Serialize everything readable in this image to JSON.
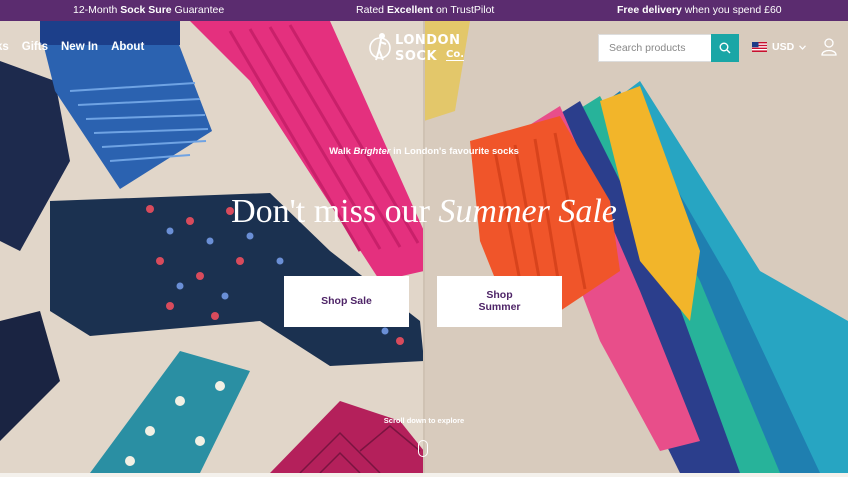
{
  "announcement": {
    "guarantee": {
      "prefix": "12-Month ",
      "bold": "Sock Sure",
      "suffix": " Guarantee"
    },
    "rating": {
      "prefix": "Rated ",
      "bold": "Excellent",
      "suffix": " on TrustPilot"
    },
    "delivery": {
      "bold": "Free delivery",
      "suffix": " when you spend £60"
    }
  },
  "nav": {
    "items": [
      "ks",
      "Gifts",
      "New In",
      "About"
    ]
  },
  "logo": {
    "line1": "LONDON",
    "line2": "SOCK",
    "co": "Co."
  },
  "search": {
    "placeholder": "Search products"
  },
  "currency": {
    "code": "USD"
  },
  "hero": {
    "tagline": {
      "prefix": "Walk ",
      "italic": "Brighter",
      "suffix": " in London's favourite socks"
    },
    "headline": {
      "prefix": "Don't miss our ",
      "italic": "Summer Sale"
    },
    "buttons": {
      "sale": "Shop Sale",
      "summer": "Shop Summer"
    },
    "scroll": "Scroll down to explore"
  },
  "colors": {
    "topbar": "#5b2c6f",
    "accent": "#1aa6a6",
    "button_text": "#4e2467"
  },
  "icons": [
    "search-icon",
    "us-flag-icon",
    "chevron-down-icon",
    "account-icon",
    "mouse-scroll-icon"
  ]
}
